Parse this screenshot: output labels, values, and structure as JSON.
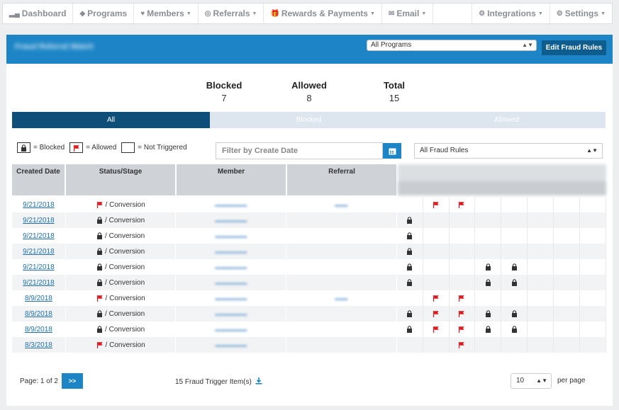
{
  "nav": {
    "dashboard": "Dashboard",
    "programs": "Programs",
    "members": "Members",
    "referrals": "Referrals",
    "rewards": "Rewards & Payments",
    "email": "Email",
    "integrations": "Integrations",
    "settings": "Settings"
  },
  "header": {
    "title": "Fraud Referral Watch",
    "program_select": "All Programs",
    "edit_button": "Edit Fraud Rules"
  },
  "stats": {
    "blocked_label": "Blocked",
    "blocked_value": "7",
    "allowed_label": "Allowed",
    "allowed_value": "8",
    "total_label": "Total",
    "total_value": "15"
  },
  "tabs": [
    "All",
    "Blocked",
    "Allowed"
  ],
  "legend": {
    "blocked": "= Blocked",
    "allowed": "= Allowed",
    "not_triggered": "= Not Triggered"
  },
  "filters": {
    "date_placeholder": "Filter by Create Date",
    "rules_select": "All Fraud Rules"
  },
  "table": {
    "columns": [
      "Created Date",
      "Status/Stage",
      "Member",
      "Referral"
    ],
    "rows": [
      {
        "date": "9/21/2018",
        "status": "allowed",
        "stage": "/ Conversion",
        "referral": true,
        "triggers": [
          "",
          "flag",
          "flag",
          "",
          "",
          "",
          "",
          ""
        ]
      },
      {
        "date": "9/21/2018",
        "status": "blocked",
        "stage": "/ Conversion",
        "referral": false,
        "triggers": [
          "lock",
          "",
          "",
          "",
          "",
          "",
          "",
          ""
        ]
      },
      {
        "date": "9/21/2018",
        "status": "blocked",
        "stage": "/ Conversion",
        "referral": false,
        "triggers": [
          "lock",
          "",
          "",
          "",
          "",
          "",
          "",
          ""
        ]
      },
      {
        "date": "9/21/2018",
        "status": "blocked",
        "stage": "/ Conversion",
        "referral": false,
        "triggers": [
          "lock",
          "",
          "",
          "",
          "",
          "",
          "",
          ""
        ]
      },
      {
        "date": "9/21/2018",
        "status": "blocked",
        "stage": "/ Conversion",
        "referral": false,
        "triggers": [
          "lock",
          "",
          "",
          "lock",
          "lock",
          "",
          "",
          ""
        ]
      },
      {
        "date": "9/21/2018",
        "status": "blocked",
        "stage": "/ Conversion",
        "referral": false,
        "triggers": [
          "lock",
          "",
          "",
          "lock",
          "lock",
          "",
          "",
          ""
        ]
      },
      {
        "date": "8/9/2018",
        "status": "allowed",
        "stage": "/ Conversion",
        "referral": true,
        "triggers": [
          "",
          "flag",
          "flag",
          "",
          "",
          "",
          "",
          ""
        ]
      },
      {
        "date": "8/9/2018",
        "status": "blocked",
        "stage": "/ Conversion",
        "referral": false,
        "triggers": [
          "lock",
          "flag",
          "flag",
          "lock",
          "lock",
          "",
          "",
          ""
        ]
      },
      {
        "date": "8/9/2018",
        "status": "blocked",
        "stage": "/ Conversion",
        "referral": false,
        "triggers": [
          "lock",
          "flag",
          "flag",
          "lock",
          "lock",
          "",
          "",
          ""
        ]
      },
      {
        "date": "8/3/2018",
        "status": "allowed",
        "stage": "/ Conversion",
        "referral": false,
        "triggers": [
          "",
          "",
          "flag",
          "",
          "",
          "",
          "",
          ""
        ]
      }
    ]
  },
  "footer": {
    "page": "Page: 1 of 2",
    "next": ">>",
    "items": "15 Fraud Trigger Item(s)",
    "per_page_value": "10",
    "per_page_label": "per page"
  },
  "colors": {
    "brand_blue": "#1d85c6",
    "dark_blue": "#0d4f78",
    "flag_red": "#e0161b"
  }
}
